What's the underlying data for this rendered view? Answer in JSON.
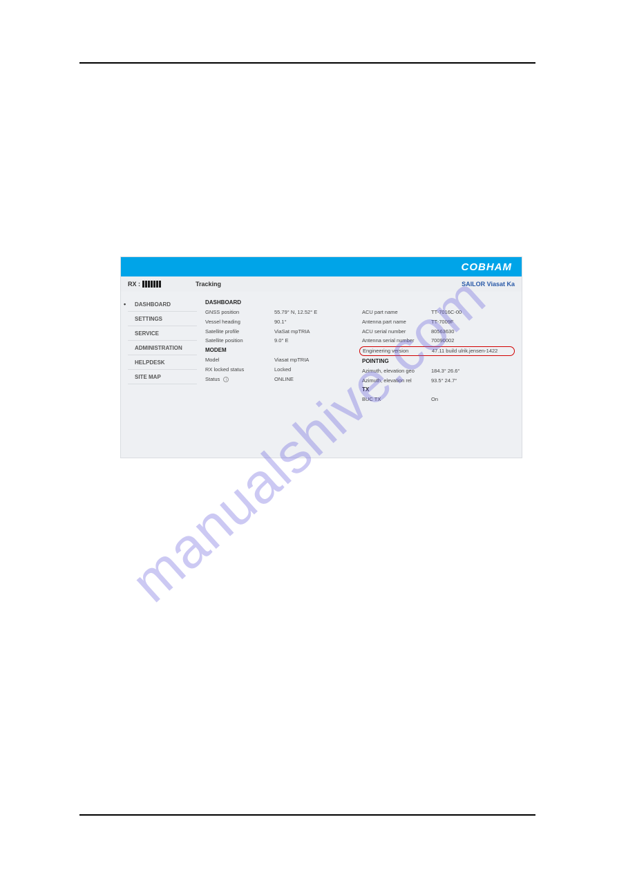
{
  "watermark": "manualshive.com",
  "header": {
    "brand": "COBHAM"
  },
  "statusbar": {
    "rx_label": "RX :",
    "tracking": "Tracking",
    "product": "SAILOR Viasat Ka"
  },
  "sidebar": {
    "items": [
      {
        "label": "DASHBOARD",
        "active": true
      },
      {
        "label": "SETTINGS",
        "active": false
      },
      {
        "label": "SERVICE",
        "active": false
      },
      {
        "label": "ADMINISTRATION",
        "active": false
      },
      {
        "label": "HELPDESK",
        "active": false
      },
      {
        "label": "SITE MAP",
        "active": false
      }
    ]
  },
  "dashboard": {
    "title": "DASHBOARD",
    "left": {
      "gnss_position": {
        "label": "GNSS position",
        "value": "55.79° N, 12.52° E"
      },
      "vessel_heading": {
        "label": "Vessel heading",
        "value": "90.1°"
      },
      "satellite_profile": {
        "label": "Satellite profile",
        "value": "ViaSat mpTRIA"
      },
      "satellite_position": {
        "label": "Satellite position",
        "value": "9.0° E"
      }
    },
    "modem": {
      "title": "MODEM",
      "model": {
        "label": "Model",
        "value": "Viasat mpTRIA"
      },
      "rx_locked": {
        "label": "RX locked status",
        "value": "Locked"
      },
      "status": {
        "label": "Status",
        "value": "ONLINE"
      }
    },
    "right": {
      "acu_part": {
        "label": "ACU part name",
        "value": "TT-7016C-00"
      },
      "ant_part": {
        "label": "Antenna part name",
        "value": "TT-7009F"
      },
      "acu_serial": {
        "label": "ACU serial number",
        "value": "80563630"
      },
      "ant_serial": {
        "label": "Antenna serial number",
        "value": "70090002"
      },
      "eng_version": {
        "label": "Engineering version",
        "value": "47.11 build ulrik.jensen-1422"
      }
    },
    "pointing": {
      "title": "POINTING",
      "az_el_geo": {
        "label": "Azimuth, elevation geo",
        "value": "184.3° 26.6°"
      },
      "az_el_rel": {
        "label": "Azimuth, elevation rel",
        "value": "93.5° 24.7°"
      }
    },
    "tx": {
      "title": "TX",
      "buc_tx": {
        "label": "BUC TX",
        "value": "On"
      }
    }
  }
}
